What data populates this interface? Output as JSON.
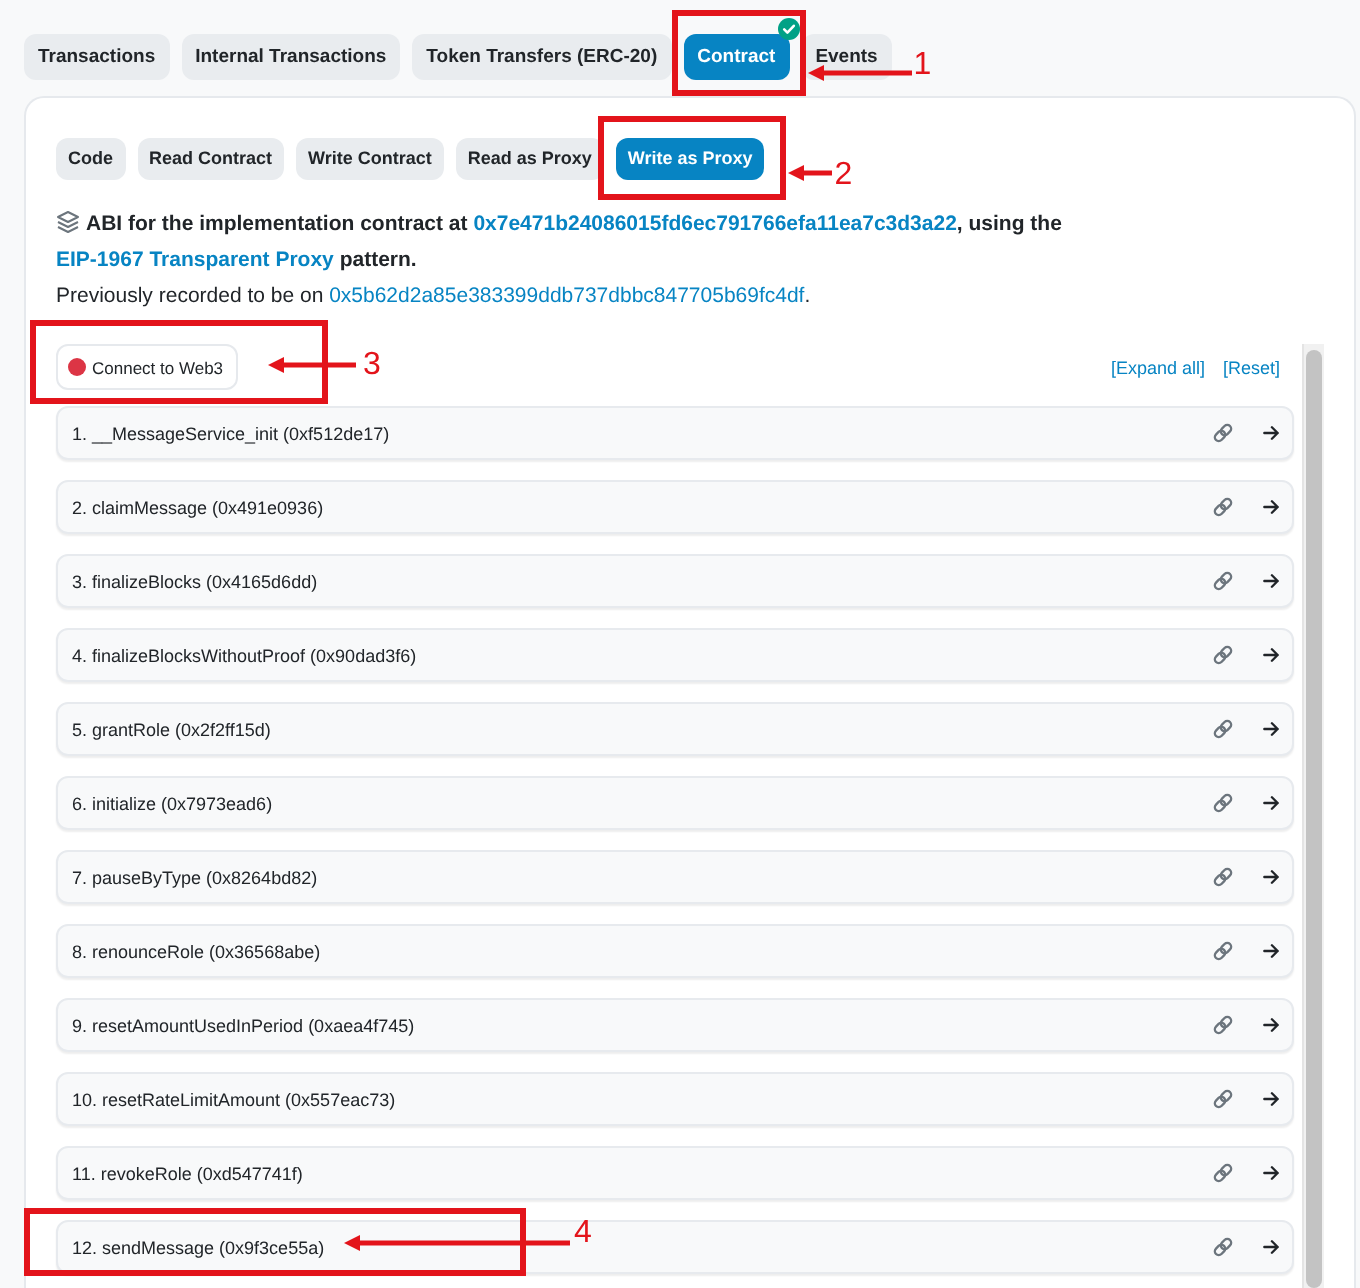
{
  "tabs": [
    {
      "label": "Transactions",
      "selected": false,
      "verified": false
    },
    {
      "label": "Internal Transactions",
      "selected": false,
      "verified": false
    },
    {
      "label": "Token Transfers (ERC-20)",
      "selected": false,
      "verified": false
    },
    {
      "label": "Contract",
      "selected": true,
      "verified": true,
      "annotation": "1"
    },
    {
      "label": "Events",
      "selected": false,
      "verified": false
    }
  ],
  "sub_tabs": [
    {
      "label": "Code",
      "selected": false
    },
    {
      "label": "Read Contract",
      "selected": false
    },
    {
      "label": "Write Contract",
      "selected": false
    },
    {
      "label": "Read as Proxy",
      "selected": false
    },
    {
      "label": "Write as Proxy",
      "selected": true,
      "annotation": "2"
    }
  ],
  "abi_note": {
    "parts": [
      {
        "kind": "text",
        "text": "ABI for the implementation contract at "
      },
      {
        "kind": "link",
        "text": "0x7e471b24086015fd6ec791766efa11ea7c3d3a22"
      },
      {
        "kind": "text",
        "text": ", using the "
      },
      {
        "kind": "link",
        "text": "EIP-1967 Transparent Proxy"
      },
      {
        "kind": "text",
        "text": " pattern."
      }
    ]
  },
  "previous_note": {
    "parts": [
      {
        "kind": "text",
        "text": "Previously recorded to be on "
      },
      {
        "kind": "link",
        "text": "0x5b62d2a85e383399ddb737dbbc847705b69fc4df"
      },
      {
        "kind": "text",
        "text": "."
      }
    ]
  },
  "connect_button": {
    "label": "Connect to Web3",
    "connected": false,
    "annotation": "3"
  },
  "list_actions": [
    "[Expand all]",
    "[Reset]"
  ],
  "functions": [
    {
      "label": "1. __MessageService_init (0xf512de17)"
    },
    {
      "label": "2. claimMessage (0x491e0936)"
    },
    {
      "label": "3. finalizeBlocks (0x4165d6dd)"
    },
    {
      "label": "4. finalizeBlocksWithoutProof (0x90dad3f6)"
    },
    {
      "label": "5. grantRole (0x2f2ff15d)"
    },
    {
      "label": "6. initialize (0x7973ead6)"
    },
    {
      "label": "7. pauseByType (0x8264bd82)"
    },
    {
      "label": "8. renounceRole (0x36568abe)"
    },
    {
      "label": "9. resetAmountUsedInPeriod (0xaea4f745)"
    },
    {
      "label": "10. resetRateLimitAmount (0x557eac73)"
    },
    {
      "label": "11. revokeRole (0xd547741f)"
    },
    {
      "label": "12. sendMessage (0x9f3ce55a)",
      "annotation": "4"
    }
  ]
}
